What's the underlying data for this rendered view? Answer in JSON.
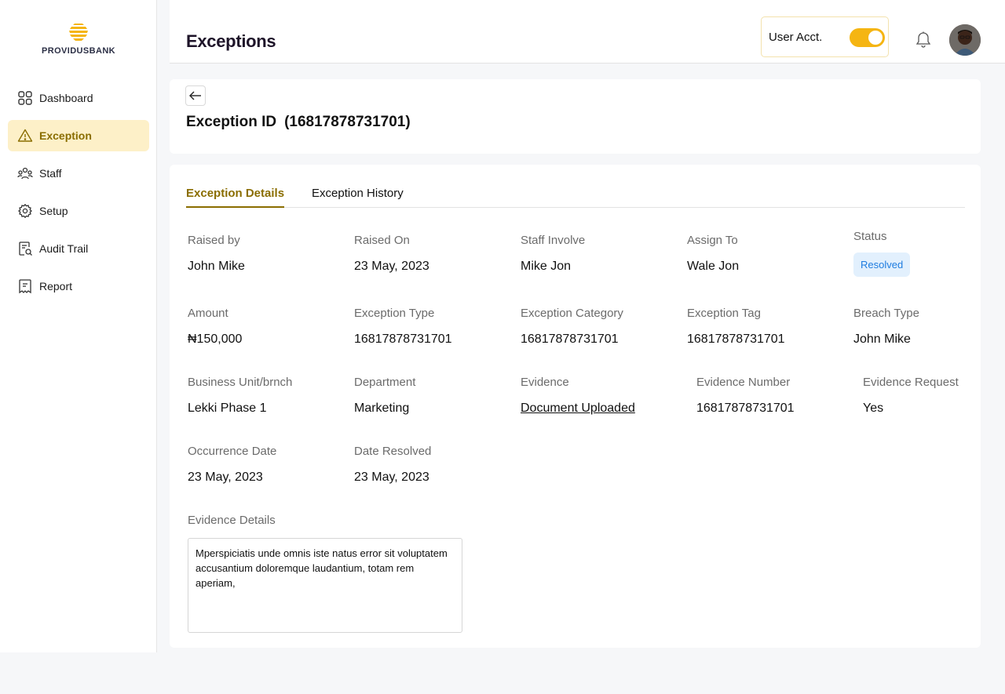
{
  "brand": {
    "name": "PROVIDUSBANK",
    "accent": "#f5b512",
    "active_text": "#8a6d00"
  },
  "sidebar": {
    "items": [
      {
        "label": "Dashboard",
        "icon": "grid-icon"
      },
      {
        "label": "Exception",
        "icon": "warning-icon",
        "active": true
      },
      {
        "label": "Staff",
        "icon": "staff-icon"
      },
      {
        "label": "Setup",
        "icon": "gear-icon"
      },
      {
        "label": "Audit Trail",
        "icon": "audit-icon"
      },
      {
        "label": "Report",
        "icon": "report-icon"
      }
    ]
  },
  "header": {
    "title": "Exceptions",
    "account_label": "User Acct.",
    "toggle_on": true
  },
  "exception": {
    "id_label": "Exception ID",
    "id_value": "(16817878731701)"
  },
  "tabs": [
    {
      "label": "Exception Details",
      "active": true
    },
    {
      "label": "Exception History",
      "active": false
    }
  ],
  "details": {
    "raised_by": {
      "label": "Raised  by",
      "value": "John Mike"
    },
    "raised_on": {
      "label": "Raised On",
      "value": "23 May, 2023"
    },
    "staff_involve": {
      "label": "Staff Involve",
      "value": "Mike Jon"
    },
    "assign_to": {
      "label": "Assign To",
      "value": "Wale Jon"
    },
    "status": {
      "label": "Status",
      "value": "Resolved",
      "color": "#1f7de0"
    },
    "amount": {
      "label": "Amount",
      "value": "₦150,000"
    },
    "exception_type": {
      "label": "Exception Type",
      "value": "16817878731701"
    },
    "exception_category": {
      "label": "Exception Category",
      "value": "16817878731701"
    },
    "exception_tag": {
      "label": "Exception Tag",
      "value": "16817878731701"
    },
    "breach_type": {
      "label": "Breach Type",
      "value": "John Mike"
    },
    "business_unit": {
      "label": "Business Unit/brnch",
      "value": "Lekki Phase 1"
    },
    "department": {
      "label": "Department",
      "value": "Marketing"
    },
    "evidence": {
      "label": "Evidence",
      "value": "Document Uploaded"
    },
    "evidence_number": {
      "label": "Evidence Number",
      "value": "16817878731701"
    },
    "evidence_request": {
      "label": "Evidence Request",
      "value": "Yes"
    },
    "occurrence_date": {
      "label": "Occurrence Date",
      "value": "23 May, 2023"
    },
    "date_resolved": {
      "label": "Date Resolved",
      "value": "23 May, 2023"
    },
    "evidence_details": {
      "label": "Evidence Details",
      "value": "Mperspiciatis unde omnis iste natus error sit voluptatem accusantium doloremque laudantium, totam rem aperiam,"
    }
  }
}
